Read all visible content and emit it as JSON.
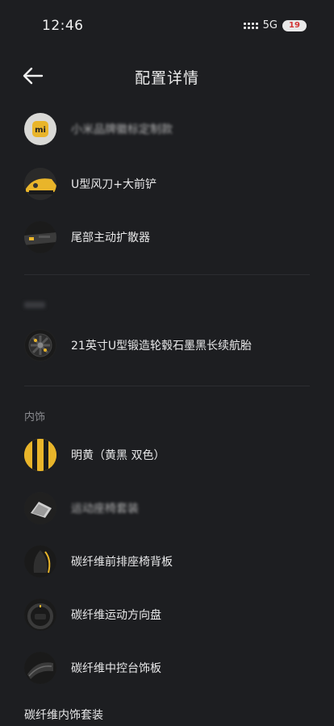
{
  "status_bar": {
    "time": "12:46",
    "network": "5G",
    "battery": "19"
  },
  "nav": {
    "title": "配置详情"
  },
  "exterior_items": [
    {
      "label": "小米品牌徽标定制款",
      "icon": "mi-logo-icon"
    },
    {
      "label": "U型风刀+大前铲",
      "icon": "front-wing-icon"
    },
    {
      "label": "尾部主动扩散器",
      "icon": "rear-diffuser-icon"
    }
  ],
  "wheel_item": {
    "label": "21英寸U型锻造轮毂石墨黑长续航胎",
    "icon": "wheel-icon"
  },
  "interior_section": {
    "title": "内饰"
  },
  "interior_items": [
    {
      "label": "明黄（黄黑 双色）",
      "icon": "color-swatch-icon"
    },
    {
      "label": "运动座椅套装",
      "icon": "seat-icon"
    },
    {
      "label": "碳纤维前排座椅背板",
      "icon": "seat-back-icon"
    },
    {
      "label": "碳纤维运动方向盘",
      "icon": "steering-wheel-icon"
    },
    {
      "label": "碳纤维中控台饰板",
      "icon": "console-trim-icon"
    }
  ],
  "bottom_label": "碳纤维内饰套装",
  "colors": {
    "background": "#1d1e21",
    "accent_yellow": "#e9b52a",
    "divider": "#2c2d31"
  }
}
